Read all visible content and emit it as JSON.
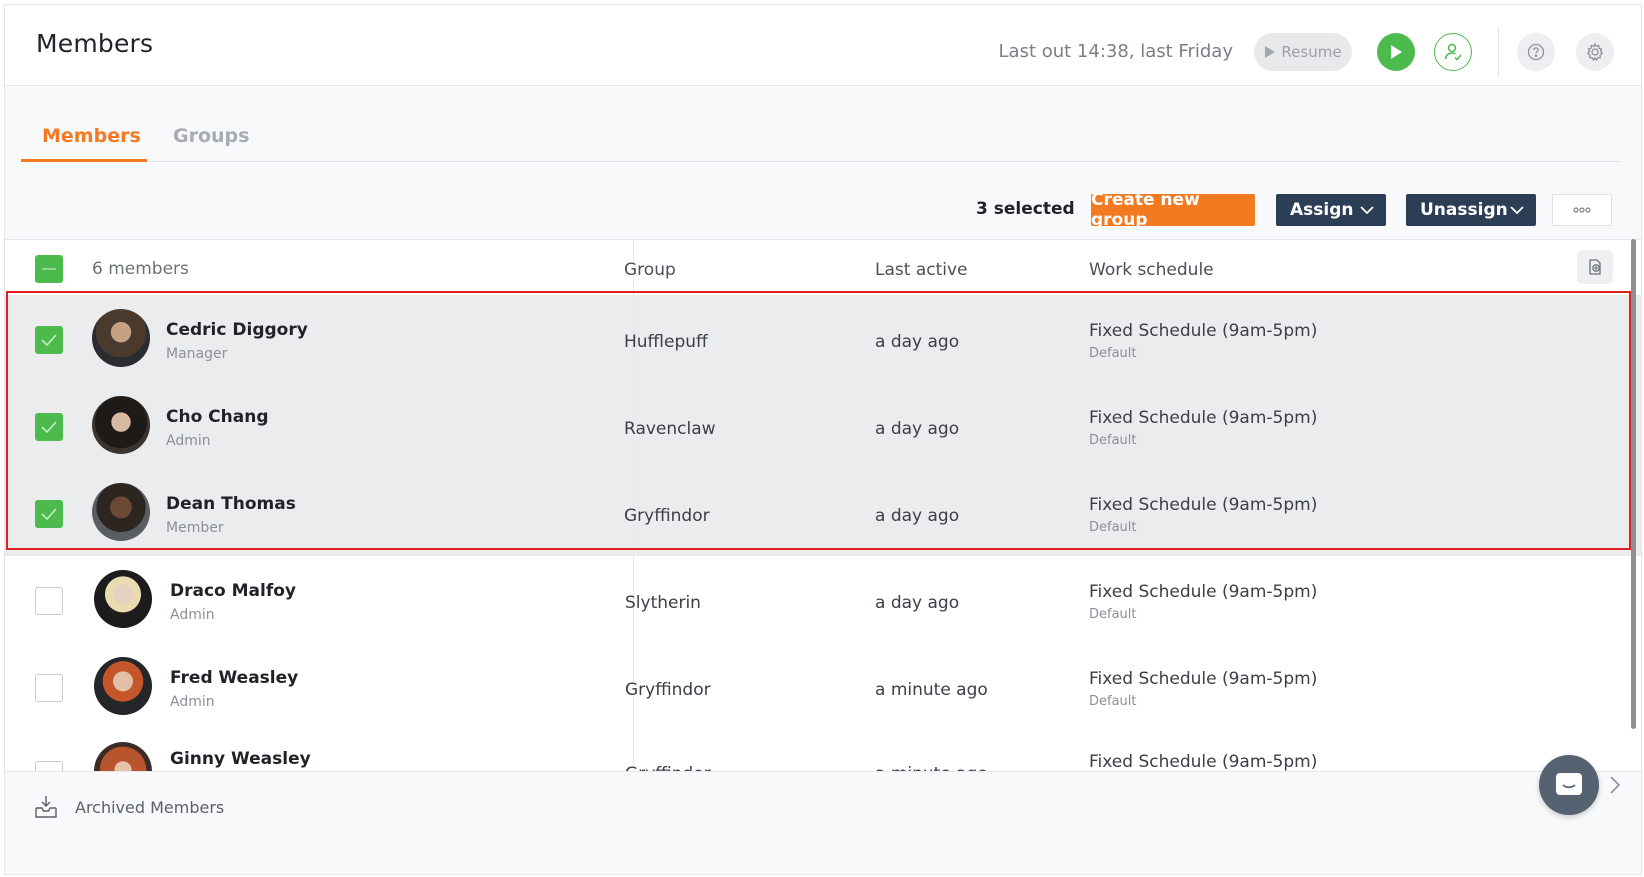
{
  "header": {
    "title": "Members",
    "last_out": "Last out 14:38, last Friday",
    "resume_label": "Resume"
  },
  "tabs": [
    {
      "label": "Members",
      "active": true
    },
    {
      "label": "Groups",
      "active": false
    }
  ],
  "toolbar": {
    "selected_count": "3 selected",
    "create_group_label": "Create new group",
    "assign_label": "Assign",
    "unassign_label": "Unassign"
  },
  "table": {
    "member_count": "6 members",
    "columns": [
      "Group",
      "Last active",
      "Work schedule"
    ],
    "rows": [
      {
        "name": "Cedric Diggory",
        "role": "Manager",
        "group": "Hufflepuff",
        "last_active": "a day ago",
        "schedule": "Fixed Schedule (9am-5pm)",
        "schedule_sub": "Default",
        "selected": true
      },
      {
        "name": "Cho Chang",
        "role": "Admin",
        "group": "Ravenclaw",
        "last_active": "a day ago",
        "schedule": "Fixed Schedule (9am-5pm)",
        "schedule_sub": "Default",
        "selected": true
      },
      {
        "name": "Dean Thomas",
        "role": "Member",
        "group": "Gryffindor",
        "last_active": "a day ago",
        "schedule": "Fixed Schedule (9am-5pm)",
        "schedule_sub": "Default",
        "selected": true
      },
      {
        "name": "Draco Malfoy",
        "role": "Admin",
        "group": "Slytherin",
        "last_active": "a day ago",
        "schedule": "Fixed Schedule (9am-5pm)",
        "schedule_sub": "Default",
        "selected": false
      },
      {
        "name": "Fred Weasley",
        "role": "Admin",
        "group": "Gryffindor",
        "last_active": "a minute ago",
        "schedule": "Fixed Schedule (9am-5pm)",
        "schedule_sub": "Default",
        "selected": false
      },
      {
        "name": "Ginny Weasley",
        "role": "",
        "group": "Gryffindor",
        "last_active": "a minute ago",
        "schedule": "Fixed Schedule (9am-5pm)",
        "schedule_sub": "",
        "selected": false
      }
    ]
  },
  "footer": {
    "archived_label": "Archived Members"
  },
  "colors": {
    "accent": "#f47a22",
    "success": "#4cba4d",
    "navy": "#2c3e55",
    "highlight": "#e02020"
  }
}
